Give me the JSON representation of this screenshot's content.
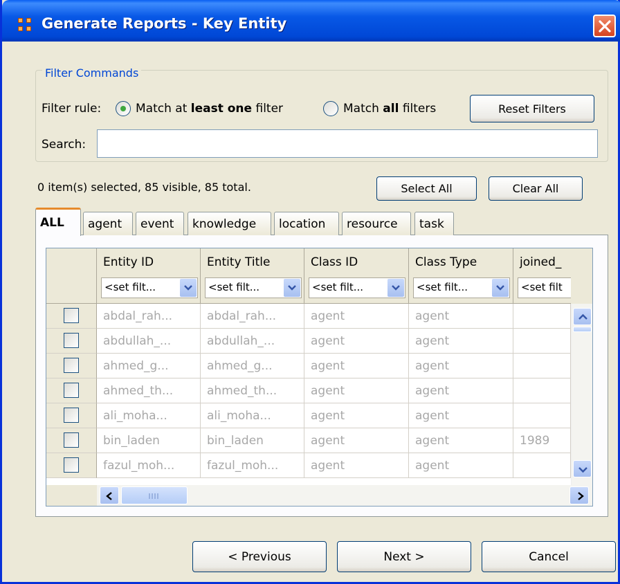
{
  "window": {
    "title": "Generate Reports - Key Entity"
  },
  "filters": {
    "legend": "Filter Commands",
    "rule_label": "Filter rule:",
    "option1_pre": "Match at ",
    "option1_bold": "least one",
    "option1_post": " filter",
    "option2_pre": "Match ",
    "option2_bold": "all",
    "option2_post": " filters",
    "selected_option": "least one",
    "reset_label": "Reset Filters",
    "search_label": "Search:",
    "search_value": ""
  },
  "status": {
    "text": "0 item(s) selected, 85 visible, 85 total.",
    "select_all_label": "Select All",
    "clear_all_label": "Clear All"
  },
  "tabs": [
    {
      "label": "ALL",
      "active": true
    },
    {
      "label": "agent",
      "active": false
    },
    {
      "label": "event",
      "active": false
    },
    {
      "label": "knowledge",
      "active": false
    },
    {
      "label": "location",
      "active": false
    },
    {
      "label": "resource",
      "active": false
    },
    {
      "label": "task",
      "active": false
    }
  ],
  "table": {
    "columns": [
      {
        "title": "Entity ID",
        "filter": "<set filt..."
      },
      {
        "title": "Entity Title",
        "filter": "<set filt..."
      },
      {
        "title": "Class ID",
        "filter": "<set filt..."
      },
      {
        "title": "Class Type",
        "filter": "<set filt..."
      },
      {
        "title": "joined_",
        "filter": "<set filt"
      }
    ],
    "rows": [
      [
        "abdal_rah...",
        "abdal_rah...",
        "agent",
        "agent",
        ""
      ],
      [
        "abdullah_...",
        "abdullah_...",
        "agent",
        "agent",
        ""
      ],
      [
        "ahmed_g...",
        "ahmed_g...",
        "agent",
        "agent",
        ""
      ],
      [
        "ahmed_th...",
        "ahmed_th...",
        "agent",
        "agent",
        ""
      ],
      [
        "ali_moha...",
        "ali_moha...",
        "agent",
        "agent",
        ""
      ],
      [
        "bin_laden",
        "bin_laden",
        "agent",
        "agent",
        "1989"
      ],
      [
        "fazul_moh...",
        "fazul_moh...",
        "agent",
        "agent",
        ""
      ]
    ]
  },
  "footer": {
    "previous_label": "< Previous",
    "next_label": "Next >",
    "cancel_label": "Cancel"
  },
  "colors": {
    "titlebar": "#0054e3",
    "dialog_bg": "#ece9d8",
    "legend_text": "#0046d5",
    "active_tab_accent": "#e68b2c"
  }
}
